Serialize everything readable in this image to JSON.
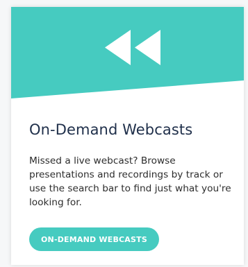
{
  "card": {
    "title": "On-Demand Webcasts",
    "description": "Missed a live webcast? Browse presentations and recordings by track or use the search bar to find just what you're looking for.",
    "button_label": "ON-DEMAND WEBCASTS",
    "hero_icon": "rewind-icon"
  },
  "colors": {
    "accent": "#46cbc0",
    "title": "#1f2f4a",
    "text": "#2d2d2d",
    "card_bg": "#ffffff",
    "page_bg": "#f6f7f8"
  }
}
